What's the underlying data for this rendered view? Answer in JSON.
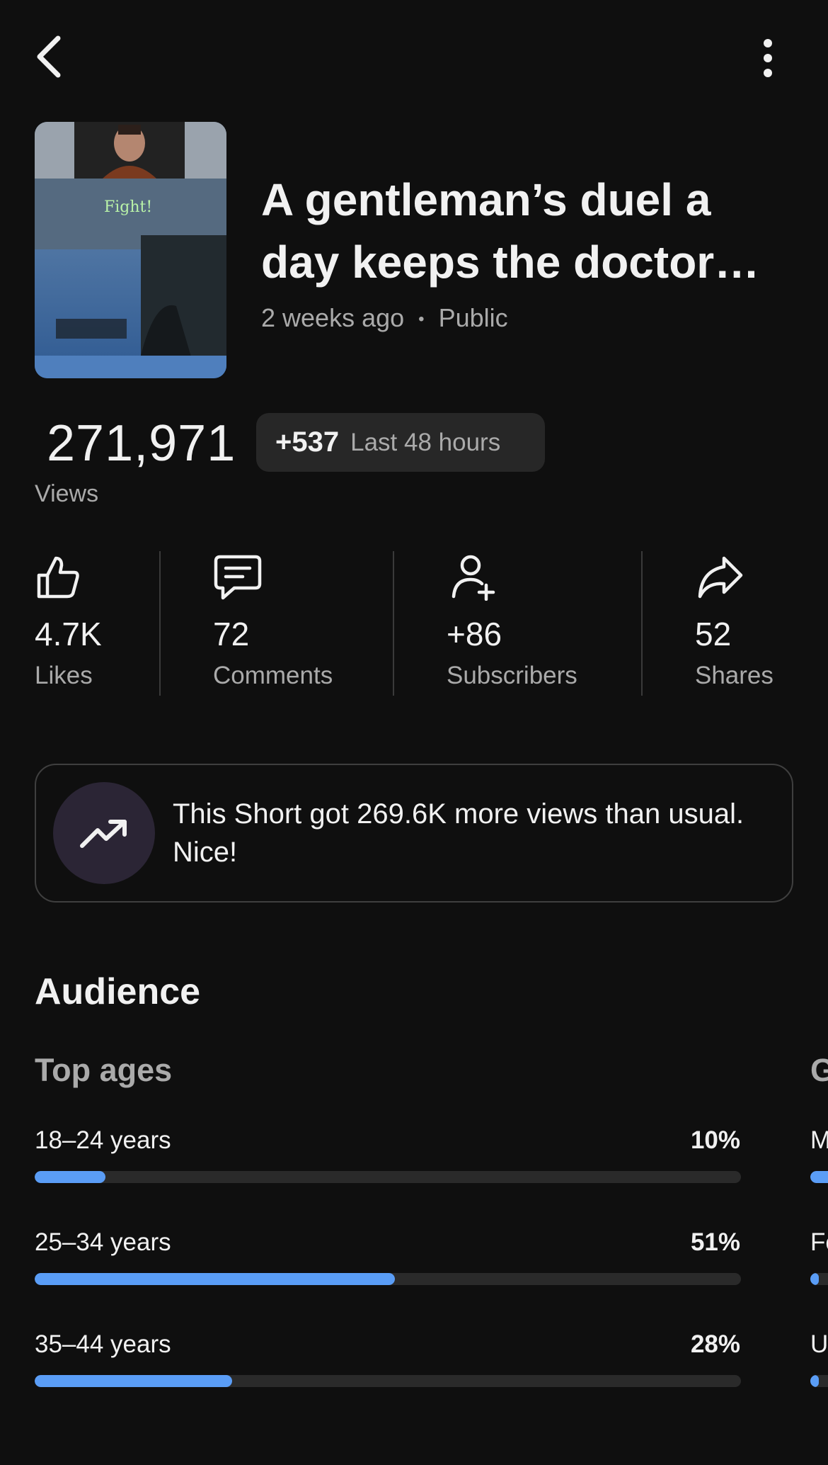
{
  "header": {
    "back_icon": "back-arrow-icon",
    "more_icon": "more-vertical-icon"
  },
  "video": {
    "title": "A gentleman’s duel a day keeps the doctor…",
    "age": "2 weeks ago",
    "separator": "•",
    "visibility": "Public",
    "thumbnail_caption": "Fight!"
  },
  "views": {
    "count": "271,971",
    "label": "Views",
    "delta": "+537",
    "delta_label": "Last 48 hours"
  },
  "stats": [
    {
      "icon": "thumbs-up-icon",
      "value": "4.7K",
      "label": "Likes"
    },
    {
      "icon": "comment-icon",
      "value": "72",
      "label": "Comments"
    },
    {
      "icon": "add-person-icon",
      "value": "+86",
      "label": "Subscribers"
    },
    {
      "icon": "share-icon",
      "value": "52",
      "label": "Shares"
    }
  ],
  "insight": {
    "icon": "trending-up-icon",
    "text": "This Short got 269.6K more views than usual. Nice!"
  },
  "audience": {
    "title": "Audience",
    "top_ages": {
      "title": "Top ages",
      "rows": [
        {
          "label": "18–24 years",
          "percent": "10%",
          "fraction": 0.1
        },
        {
          "label": "25–34 years",
          "percent": "51%",
          "fraction": 0.51
        },
        {
          "label": "35–44 years",
          "percent": "28%",
          "fraction": 0.28
        }
      ]
    },
    "gender": {
      "title": "G",
      "rows": [
        {
          "label": "M",
          "fraction": 0.8
        },
        {
          "label": "Fe",
          "fraction": 0.15
        },
        {
          "label": "U",
          "fraction": 0.05
        }
      ]
    }
  },
  "colors": {
    "background": "#0f0f0f",
    "accent": "#5a9df6",
    "muted_text": "#aaaaaa",
    "chip": "#272727"
  }
}
